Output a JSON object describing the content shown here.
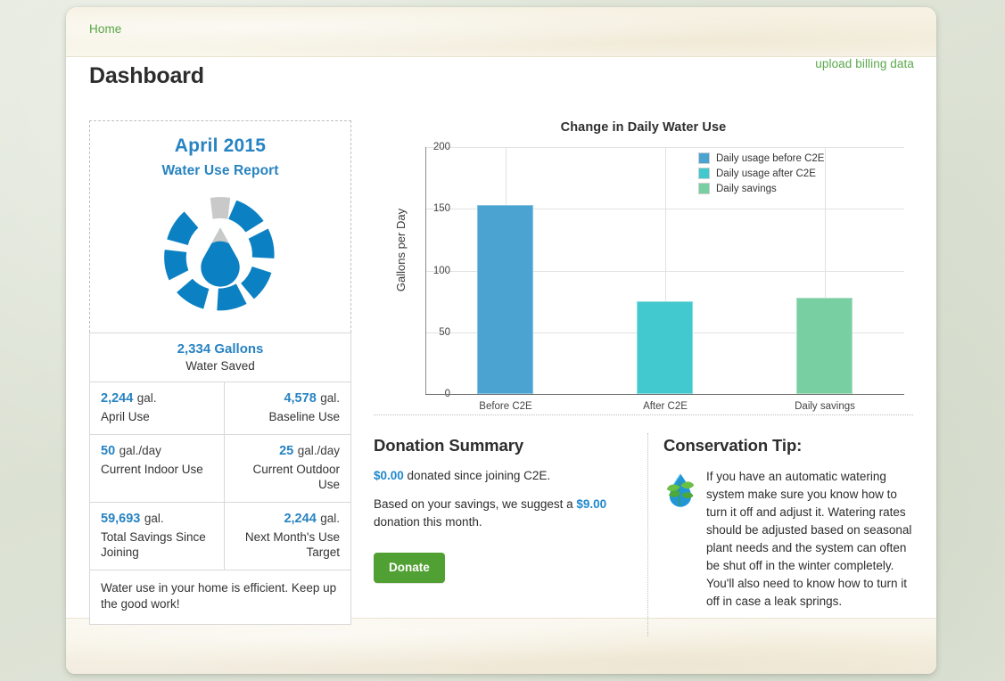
{
  "header": {
    "breadcrumb": "Home",
    "title": "Dashboard",
    "upload_link": "upload billing data"
  },
  "report_card": {
    "month": "April 2015",
    "subtitle": "Water Use Report",
    "logo_icon": "water-drop-logo",
    "water_saved": {
      "value": "2,334 Gallons",
      "label": "Water Saved"
    },
    "stats": [
      {
        "value": "2,244",
        "unit": "gal.",
        "label": "April Use",
        "align": "left"
      },
      {
        "value": "4,578",
        "unit": "gal.",
        "label": "Baseline Use",
        "align": "right"
      },
      {
        "value": "50",
        "unit": "gal./day",
        "label": "Current\nIndoor Use",
        "align": "left"
      },
      {
        "value": "25",
        "unit": "gal./day",
        "label": "Current\nOutdoor Use",
        "align": "right"
      },
      {
        "value": "59,693",
        "unit": "gal.",
        "label": "Total Savings\nSince Joining",
        "align": "left"
      },
      {
        "value": "2,244",
        "unit": "gal.",
        "label": "Next Month's\nUse Target",
        "align": "right"
      }
    ],
    "note": "Water use in your home is efficient. Keep up the good work!"
  },
  "chart_data": {
    "type": "bar",
    "title": "Change in Daily Water Use",
    "xlabel": "",
    "ylabel": "Gallons per Day",
    "categories": [
      "Before C2E",
      "After C2E",
      "Daily savings"
    ],
    "values": [
      153,
      75,
      78
    ],
    "ylim": [
      0,
      200
    ],
    "yticks": [
      0,
      50,
      100,
      150,
      200
    ],
    "grid": true,
    "legend_position": "top-right",
    "legend": [
      {
        "label": "Daily usage before C2E",
        "color": "#4aa3d1"
      },
      {
        "label": "Daily usage after C2E",
        "color": "#42c8cf"
      },
      {
        "label": "Daily savings",
        "color": "#78cfa1"
      }
    ]
  },
  "donation": {
    "title": "Donation Summary",
    "donated_amount": "$0.00",
    "donated_text": " donated since joining C2E.",
    "suggest_prefix": "Based on your savings, we suggest a ",
    "suggest_amount": "$9.00",
    "suggest_suffix": " donation this month.",
    "button_label": "Donate"
  },
  "conservation_tip": {
    "title": "Conservation Tip:",
    "icon": "water-drop-leaf-icon",
    "text": "If you have an automatic watering system make sure you know how to turn it off and adjust it. Watering rates should be adjusted based on seasonal plant needs and the system can often be shut off in the winter completely. You'll also need to know how to turn it off in case a leak springs."
  },
  "colors": {
    "brand_blue": "#2783c2",
    "brand_green": "#50a033",
    "bar_before": "#4aa3d1",
    "bar_after": "#42c8cf",
    "bar_savings": "#78cfa1",
    "page_bg": "#dfe4d8"
  }
}
